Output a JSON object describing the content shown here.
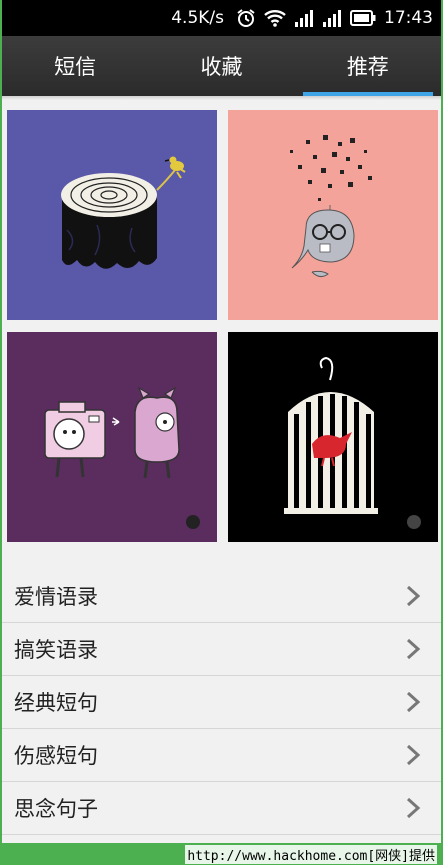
{
  "status_bar": {
    "net_speed": "4.5K/s",
    "time": "17:43",
    "icons": [
      "alarm-icon",
      "wifi-icon",
      "signal-icon",
      "signal-icon",
      "battery-icon"
    ]
  },
  "tabs": [
    {
      "label": "短信",
      "active": false
    },
    {
      "label": "收藏",
      "active": false
    },
    {
      "label": "推荐",
      "active": true
    }
  ],
  "tiles": [
    {
      "name": "tree-stump-bird",
      "bg": "#5a58a8"
    },
    {
      "name": "whale-glasses",
      "bg": "#f4a39a"
    },
    {
      "name": "camera-pig",
      "bg": "#5a2d5e"
    },
    {
      "name": "birdcage-piano",
      "bg": "#000000"
    }
  ],
  "list": [
    {
      "label": "爱情语录"
    },
    {
      "label": "搞笑语录"
    },
    {
      "label": "经典短句"
    },
    {
      "label": "伤感短句"
    },
    {
      "label": "思念句子"
    }
  ],
  "footer": {
    "text": "http://www.hackhome.com[网侠]提供"
  }
}
